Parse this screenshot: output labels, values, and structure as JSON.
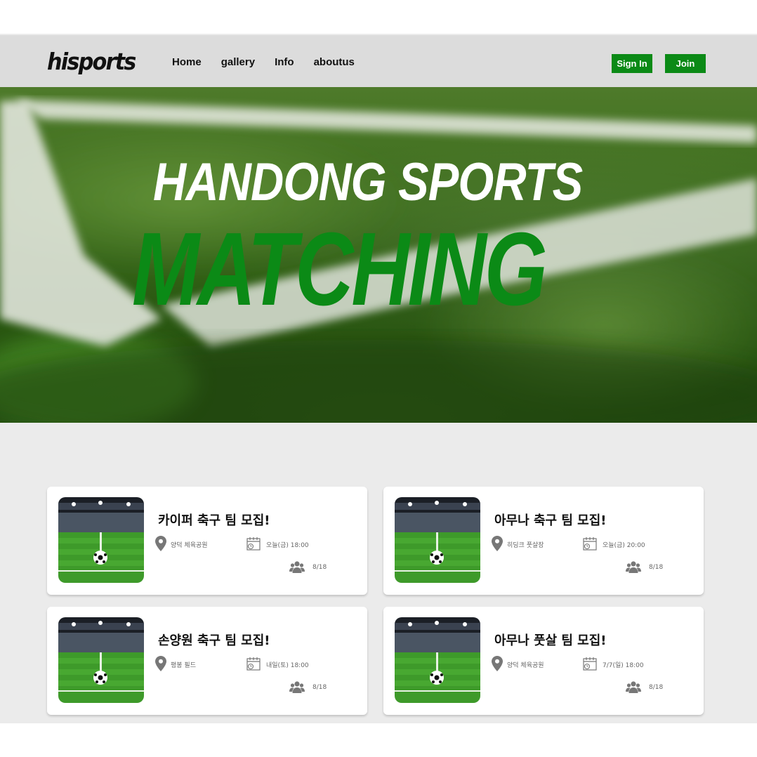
{
  "header": {
    "logo": "hisports",
    "nav": [
      "Home",
      "gallery",
      "Info",
      "aboutus"
    ],
    "sign_in": "Sign In",
    "join": "Join"
  },
  "hero": {
    "line1": "HANDONG SPORTS",
    "line2": "MATCHING"
  },
  "colors": {
    "accent": "#0b8a16",
    "navbar": "#dcdcdc",
    "content_bg": "#ebebeb"
  },
  "cards": [
    {
      "title": "카이퍼 축구 팀 모집!",
      "location": "양덕 체육공원",
      "datetime": "오늘(금) 18:00",
      "participants": "8/18"
    },
    {
      "title": "아무나 축구 팀 모집!",
      "location": "히딩크 풋살장",
      "datetime": "오늘(금) 20:00",
      "participants": "8/18"
    },
    {
      "title": "손양원 축구 팀 모집!",
      "location": "평봉 필드",
      "datetime": "내일(토) 18:00",
      "participants": "8/18"
    },
    {
      "title": "아무나 풋살 팀 모집!",
      "location": "양덕 체육공원",
      "datetime": "7/7(일) 18:00",
      "participants": "8/18"
    }
  ]
}
